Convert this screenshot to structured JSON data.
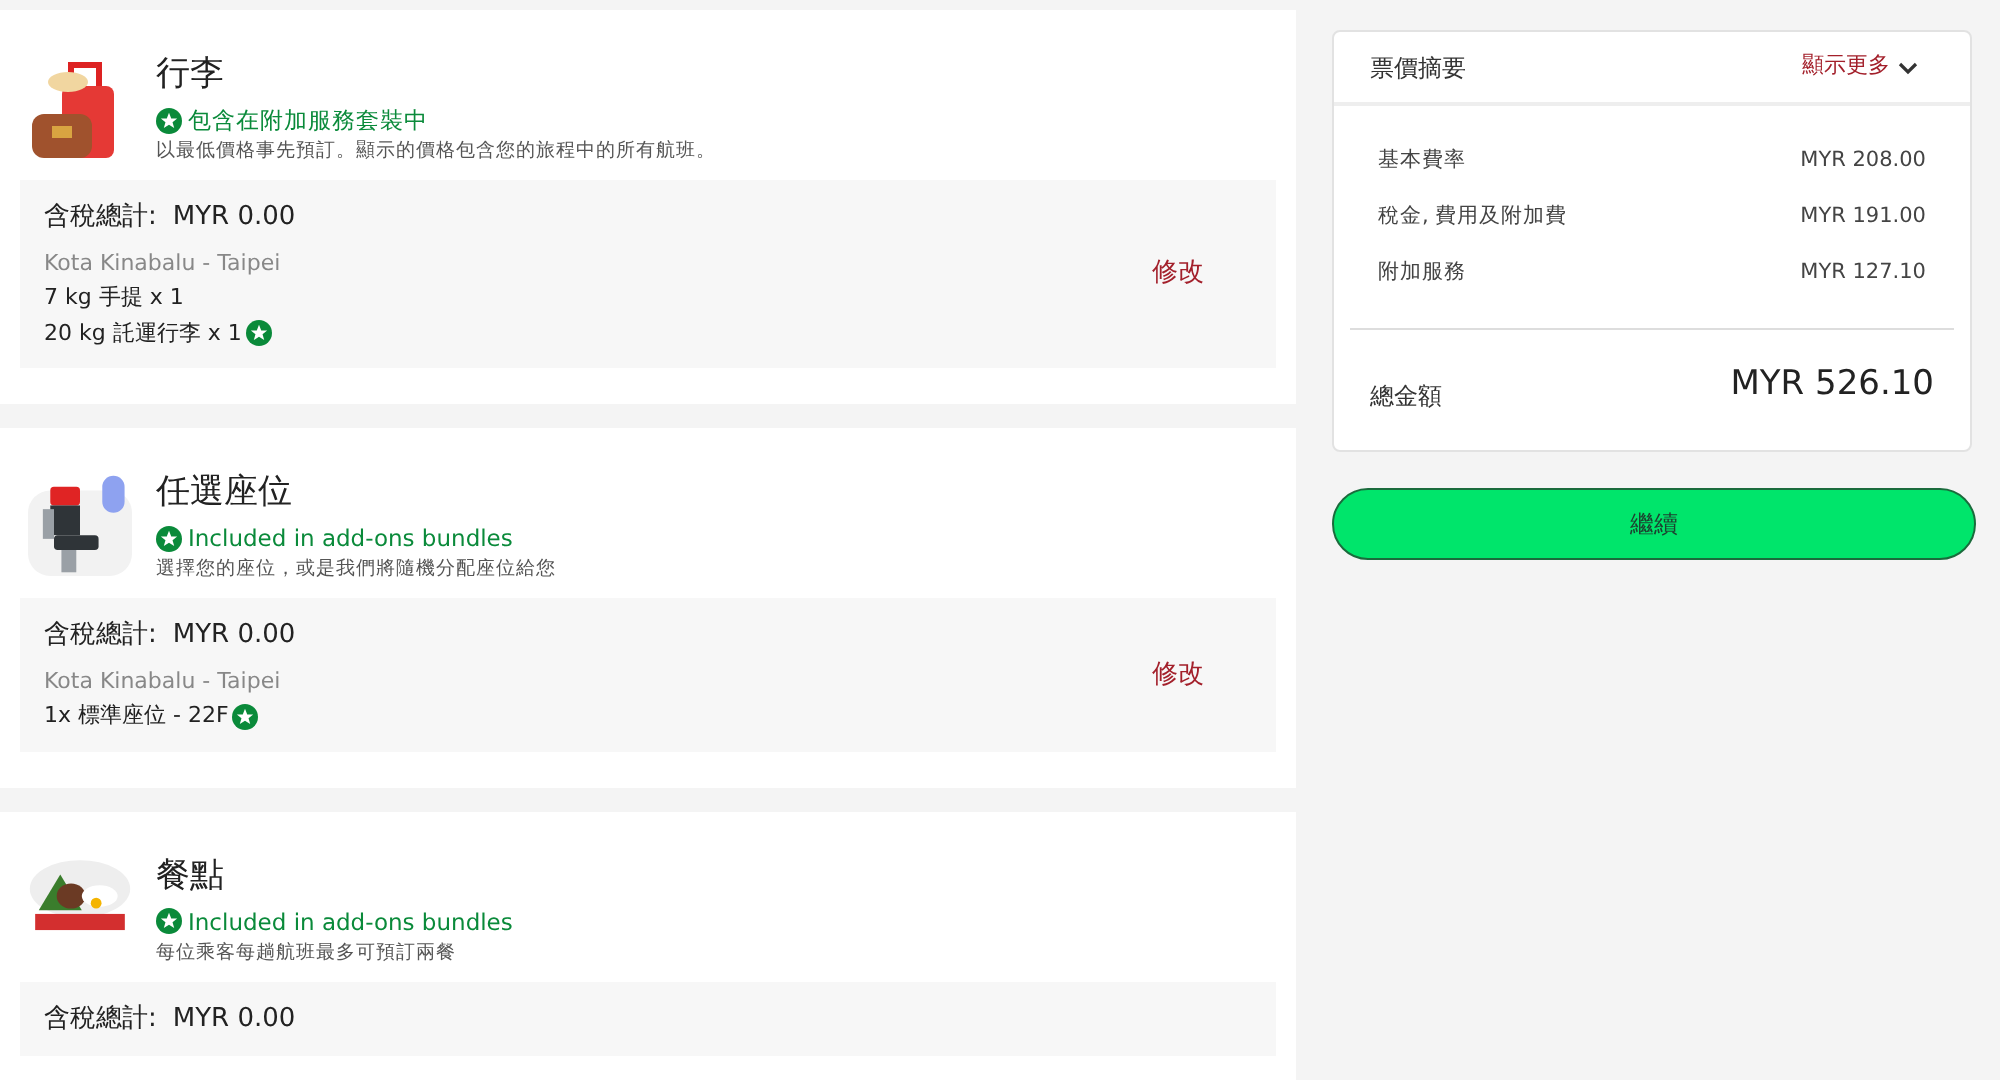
{
  "sections": [
    {
      "kind": "baggage",
      "title": "行李",
      "bundle_note": "包含在附加服務套裝中",
      "description": "以最低價格事先預訂。顯示的價格包含您的旅程中的所有航班。",
      "total_label": "含稅總計:",
      "total": "MYR 0.00",
      "route": "Kota Kinabalu - Taipei",
      "lines": [
        {
          "text": "7 kg 手提 x 1",
          "bundled": false
        },
        {
          "text": "20 kg 託運行李 x 1",
          "bundled": true
        }
      ],
      "edit": "修改"
    },
    {
      "kind": "seat",
      "title": "任選座位",
      "bundle_note": "Included in add-ons bundles",
      "description": "選擇您的座位，或是我們將隨機分配座位給您",
      "total_label": "含稅總計:",
      "total": "MYR 0.00",
      "route": "Kota Kinabalu - Taipei",
      "lines": [
        {
          "text": "1x 標準座位 - 22F",
          "bundled": true
        }
      ],
      "edit": "修改"
    },
    {
      "kind": "meal",
      "title": "餐點",
      "bundle_note": "Included in add-ons bundles",
      "description": "每位乘客每趟航班最多可預訂兩餐",
      "total_label": "含稅總計:",
      "total": "MYR 0.00"
    }
  ],
  "summary": {
    "title": "票價摘要",
    "toggle": "顯示更多",
    "expanded": false,
    "rows": [
      {
        "label": "基本費率",
        "value": "MYR 208.00"
      },
      {
        "label": "稅金, 費用及附加費",
        "value": "MYR 191.00"
      },
      {
        "label": "附加服務",
        "value": "MYR 127.10"
      }
    ],
    "total_label": "總金額",
    "total": "MYR 526.10"
  },
  "continue_button": "繼續"
}
